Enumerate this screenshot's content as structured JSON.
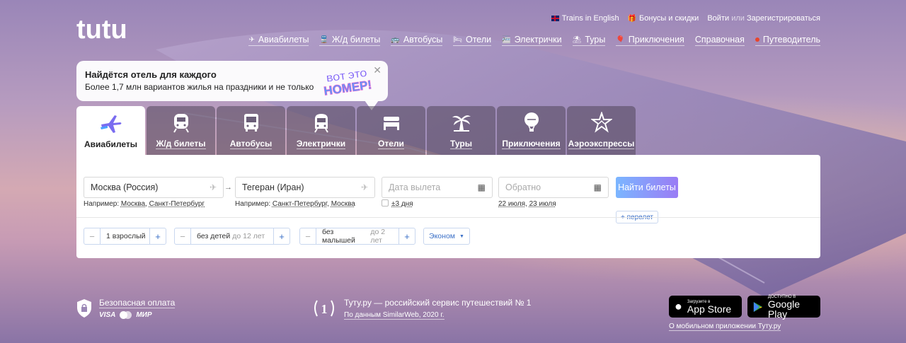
{
  "brand": {
    "logo_text": "tutu"
  },
  "topbar": {
    "trains_english": "Trains in English",
    "bonuses": "Бонусы и скидки",
    "login": "Войти",
    "or": "или",
    "register": "Зарегистрироваться"
  },
  "nav": [
    {
      "label": "Авиабилеты",
      "icon": "plane-icon"
    },
    {
      "label": "Ж/д билеты",
      "icon": "train-icon"
    },
    {
      "label": "Автобусы",
      "icon": "bus-icon"
    },
    {
      "label": "Отели",
      "icon": "bed-icon"
    },
    {
      "label": "Электрички",
      "icon": "suburban-train-icon"
    },
    {
      "label": "Туры",
      "icon": "tour-icon"
    },
    {
      "label": "Приключения",
      "icon": "balloon-icon"
    },
    {
      "label": "Справочная",
      "icon": ""
    },
    {
      "label": "Путеводитель",
      "icon": "red-dot-icon"
    }
  ],
  "promo": {
    "title": "Найдётся отель для каждого",
    "subtitle": "Более 1,7 млн вариантов жилья на праздники и не только",
    "badge_line1": "ВОТ ЭТО",
    "badge_line2": "НОМЕР!"
  },
  "tabs": [
    {
      "label": "Авиабилеты",
      "active": true
    },
    {
      "label": "Ж/д билеты",
      "active": false
    },
    {
      "label": "Автобусы",
      "active": false
    },
    {
      "label": "Электрички",
      "active": false
    },
    {
      "label": "Отели",
      "active": false
    },
    {
      "label": "Туры",
      "active": false
    },
    {
      "label": "Приключения",
      "active": false
    },
    {
      "label": "Аэроэкспрессы",
      "active": false
    }
  ],
  "search": {
    "from_value": "Москва (Россия)",
    "from_hint_prefix": "Например:",
    "from_hint_1": "Москва",
    "from_hint_2": "Санкт-Петербург",
    "to_value": "Тегеран (Иран)",
    "to_hint_prefix": "Например:",
    "to_hint_1": "Санкт-Петербург",
    "to_hint_2": "Москва",
    "depart_placeholder": "Дата вылета",
    "flex_label": "±3 дня",
    "return_placeholder": "Обратно",
    "return_hint_1": "22 июля",
    "return_hint_2": "23 июля",
    "submit": "Найти билеты",
    "add_flight": "+ перелет"
  },
  "passengers": {
    "adults": "1 взрослый",
    "children": "без детей",
    "children_note": "до 12 лет",
    "infants": "без малышей",
    "infants_note": "до 2 лет",
    "class": "Эконом"
  },
  "footer": {
    "secure_payment": "Безопасная оплата",
    "visa": "VISA",
    "mir": "МИР",
    "rank_number": "1",
    "rank_title": "Туту.ру — российский сервис путешествий № 1",
    "rank_source": "По данным SimilarWeb, 2020 г.",
    "appstore_small": "Загрузите в",
    "appstore_large": "App Store",
    "gplay_small": "ДОСТУПНО В",
    "gplay_large": "Google Play",
    "mobile_link": "О мобильном приложении Туту.ру"
  },
  "colors": {
    "accent": "#3a6fc7",
    "button_from": "#7bb6ff",
    "button_to": "#9a7cf5",
    "logo": "#6a5ae0"
  }
}
